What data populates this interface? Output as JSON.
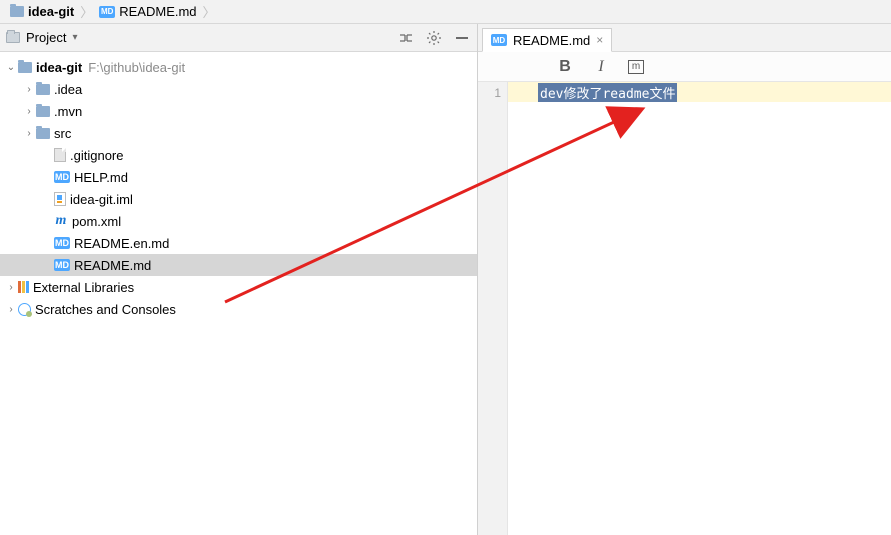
{
  "breadcrumb": {
    "project": "idea-git",
    "file": "README.md"
  },
  "projectPane": {
    "title": "Project",
    "rootName": "idea-git",
    "rootPath": "F:\\github\\idea-git",
    "folders": {
      "idea": ".idea",
      "mvn": ".mvn",
      "src": "src"
    },
    "files": {
      "gitignore": ".gitignore",
      "help": "HELP.md",
      "iml": "idea-git.iml",
      "pom": "pom.xml",
      "readmeEn": "README.en.md",
      "readme": "README.md"
    },
    "extLib": "External Libraries",
    "scratches": "Scratches and Consoles"
  },
  "editor": {
    "tabLabel": "README.md",
    "toolbar": {
      "bold": "B",
      "italic": "I",
      "m": "m"
    },
    "gutter": {
      "l1": "1"
    },
    "line1": "dev修改了readme文件"
  }
}
